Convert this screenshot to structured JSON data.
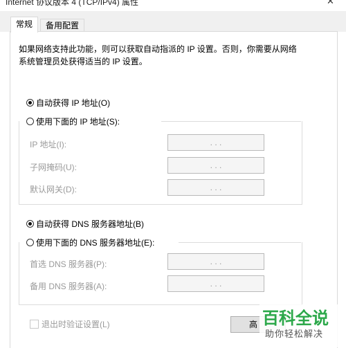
{
  "window": {
    "title": "Internet 协议版本 4 (TCP/IPv4) 属性",
    "close_glyph": "✕"
  },
  "tabs": [
    {
      "label": "常规",
      "active": true
    },
    {
      "label": "备用配置",
      "active": false
    }
  ],
  "description": "如果网络支持此功能，则可以获取自动指派的 IP 设置。否则，你需要从网络系统管理员处获得适当的 IP 设置。",
  "ip": {
    "auto_label": "自动获得 IP 地址(O)",
    "auto_selected": true,
    "manual_label": "使用下面的 IP 地址(S):",
    "manual_selected": false,
    "fields": [
      {
        "label": "IP 地址(I):",
        "value": ". . ."
      },
      {
        "label": "子网掩码(U):",
        "value": ". . ."
      },
      {
        "label": "默认网关(D):",
        "value": ". . ."
      }
    ]
  },
  "dns": {
    "auto_label": "自动获得 DNS 服务器地址(B)",
    "auto_selected": true,
    "manual_label": "使用下面的 DNS 服务器地址(E):",
    "manual_selected": false,
    "fields": [
      {
        "label": "首选 DNS 服务器(P):",
        "value": ". . ."
      },
      {
        "label": "备用 DNS 服务器(A):",
        "value": ". . ."
      }
    ]
  },
  "validate_on_exit": {
    "label": "退出时验证设置(L)",
    "checked": false
  },
  "advanced_button": "高",
  "watermark": {
    "main": "百科全说",
    "sub": "助你轻松解决"
  }
}
